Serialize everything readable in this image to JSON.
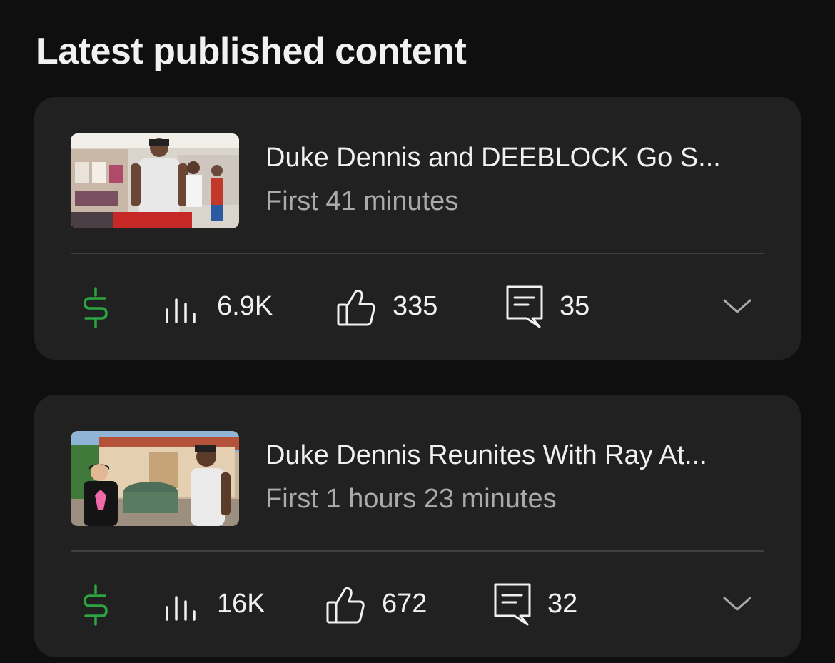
{
  "section": {
    "title": "Latest published content"
  },
  "colors": {
    "background": "#0f0f0f",
    "card": "#212121",
    "monetization_green": "#2ba640",
    "secondary_text": "#aaaaaa"
  },
  "videos": [
    {
      "title": "Duke Dennis and DEEBLOCK Go S...",
      "subtitle": "First 41 minutes",
      "thumbnail_icon": "video-thumbnail-store-scene",
      "monetization_icon": "dollar-icon",
      "views": "6.9K",
      "likes": "335",
      "comments": "35"
    },
    {
      "title": "Duke Dennis Reunites With Ray At...",
      "subtitle": "First 1 hours 23 minutes",
      "thumbnail_icon": "video-thumbnail-patio-scene",
      "monetization_icon": "dollar-icon",
      "views": "16K",
      "likes": "672",
      "comments": "32"
    }
  ]
}
